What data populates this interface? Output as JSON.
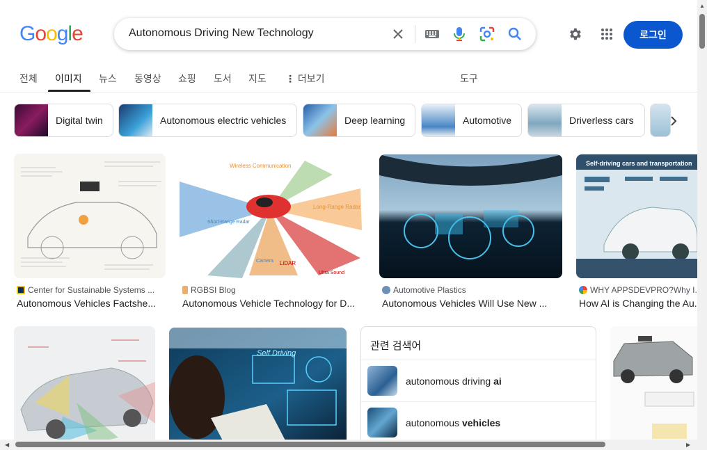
{
  "header": {
    "logo_letters": [
      "G",
      "o",
      "o",
      "g",
      "l",
      "e"
    ],
    "logo_colors": [
      "#4285f4",
      "#ea4335",
      "#fbbc05",
      "#4285f4",
      "#34a853",
      "#ea4335"
    ],
    "search_value": "Autonomous Driving New Technology",
    "clear_icon": "close-icon",
    "keyboard_icon": "keyboard-icon",
    "voice_icon": "mic-icon",
    "lens_icon": "camera-lens-icon",
    "search_icon": "search-icon",
    "settings_icon": "gear-icon",
    "apps_icon": "apps-grid-icon",
    "login_label": "로그인",
    "accent": "#0b57d0"
  },
  "tabs": [
    {
      "label": "전체"
    },
    {
      "label": "이미지",
      "active": true
    },
    {
      "label": "뉴스"
    },
    {
      "label": "동영상"
    },
    {
      "label": "쇼핑"
    },
    {
      "label": "도서"
    },
    {
      "label": "지도"
    },
    {
      "label": "더보기"
    },
    {
      "label": "도구"
    }
  ],
  "chips": [
    {
      "label": "Digital twin"
    },
    {
      "label": "Autonomous electric vehicles"
    },
    {
      "label": "Deep learning"
    },
    {
      "label": "Automotive"
    },
    {
      "label": "Driverless cars"
    }
  ],
  "results_row1": [
    {
      "source": "Center for Sustainable Systems ...",
      "title": "Autonomous Vehicles Factshe..."
    },
    {
      "source": "RGBSI Blog",
      "title": "Autonomous Vehicle Technology for D..."
    },
    {
      "source": "Automotive Plastics",
      "title": "Autonomous Vehicles Will Use New ..."
    },
    {
      "source": "WHY APPSDEVPRO?Why I...",
      "title": "How AI is Changing the Au..."
    }
  ],
  "image_text": {
    "radar_long": "Long-Range Radar",
    "radar_short": "Short-Range Radar",
    "wireless": "Wireless Communication",
    "lidar": "LiDAR",
    "camera": "Camera",
    "ultra": "Ultra Sound",
    "sdc_title": "Self-driving cars and transportation",
    "self_driving": "Self Driving"
  },
  "related": {
    "title": "관련 검색어",
    "items": [
      {
        "prefix": "autonomous driving ",
        "bold": "ai"
      },
      {
        "prefix": "autonomous ",
        "bold": "vehicles"
      }
    ]
  }
}
